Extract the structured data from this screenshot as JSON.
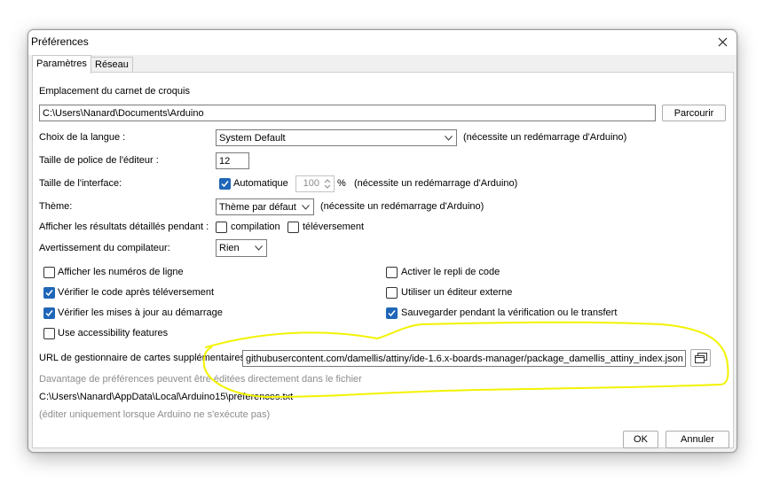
{
  "window": {
    "title": "Préférences",
    "tabs": [
      {
        "label": "Paramètres",
        "active": true
      },
      {
        "label": "Réseau",
        "active": false
      }
    ]
  },
  "sketchbook": {
    "label": "Emplacement du carnet de croquis",
    "value": "C:\\Users\\Nanard\\Documents\\Arduino",
    "browse_label": "Parcourir"
  },
  "language": {
    "label": "Choix de la langue :",
    "value": "System Default",
    "note": "(nécessite un redémarrage d'Arduino)"
  },
  "font_size": {
    "label": "Taille de police de l'éditeur :",
    "value": "12"
  },
  "interface_scale": {
    "label": "Taille de l'interface:",
    "auto_label": "Automatique",
    "auto_checked": true,
    "value": "100",
    "unit": "%",
    "note": "(nécessite un redémarrage d'Arduino)"
  },
  "theme": {
    "label": "Thème:",
    "value": "Thème par défaut",
    "note": "(nécessite un redémarrage d'Arduino)"
  },
  "verbose": {
    "label": "Afficher les résultats détaillés pendant :",
    "compile_label": "compilation",
    "compile_checked": false,
    "upload_label": "téléversement",
    "upload_checked": false
  },
  "warnings": {
    "label": "Avertissement du compilateur:",
    "value": "Rien"
  },
  "options_left": [
    {
      "label": "Afficher les numéros de ligne",
      "checked": false
    },
    {
      "label": "Vérifier le code après téléversement",
      "checked": true
    },
    {
      "label": "Vérifier les mises à jour au démarrage",
      "checked": true
    },
    {
      "label": "Use accessibility features",
      "checked": false
    }
  ],
  "options_right": [
    {
      "label": "Activer le repli de code",
      "checked": false
    },
    {
      "label": "Utiliser un éditeur externe",
      "checked": false
    },
    {
      "label": "Sauvegarder pendant la vérification ou le transfert",
      "checked": true
    }
  ],
  "boards_url": {
    "label": "URL de gestionnaire de cartes supplémentaires",
    "value": "githubusercontent.com/damellis/attiny/ide-1.6.x-boards-manager/package_damellis_attiny_index.json"
  },
  "footer": {
    "more_prefs": "Davantage de préférences peuvent être éditées directement dans le fichier",
    "prefs_path": "C:\\Users\\Nanard\\AppData\\Local\\Arduino15\\preferences.txt",
    "edit_note": "(éditer uniquement lorsque Arduino ne s'exécute pas)"
  },
  "buttons": {
    "ok": "OK",
    "cancel": "Annuler"
  },
  "colors": {
    "accent": "#1f66b8",
    "annotation": "#f2f200"
  }
}
